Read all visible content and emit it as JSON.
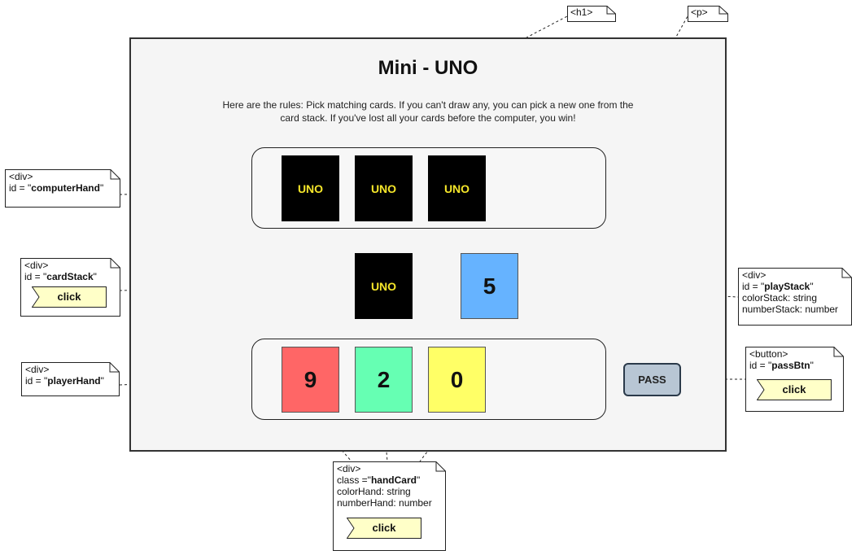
{
  "app": {
    "title": "Mini - UNO",
    "rules": "Here are the rules: Pick matching cards. If you can't draw any, you can pick a new one from the card stack. If you've lost all your cards before the computer, you win!"
  },
  "computer_hand": {
    "cards": [
      "UNO",
      "UNO",
      "UNO"
    ]
  },
  "card_stack": {
    "label": "UNO"
  },
  "play_stack": {
    "number": "5",
    "color": "#66b3ff"
  },
  "player_hand": {
    "cards": [
      {
        "number": "9",
        "color": "#ff6666"
      },
      {
        "number": "2",
        "color": "#66ffb3"
      },
      {
        "number": "0",
        "color": "#ffff66"
      }
    ]
  },
  "pass_button": {
    "label": "PASS"
  },
  "annotations": {
    "h1": {
      "tag": "<h1>"
    },
    "p": {
      "tag": "<p>"
    },
    "computer_hand": {
      "line1": "<div>",
      "line2_prefix": "id = \"",
      "line2_id": "computerHand",
      "line2_suffix": "\""
    },
    "card_stack": {
      "line1": "<div>",
      "line2_prefix": "id = \"",
      "line2_id": "cardStack",
      "line2_suffix": "\"",
      "action": "click"
    },
    "play_stack": {
      "line1": "<div>",
      "line2_prefix": "id = \"",
      "line2_id": "playStack",
      "line2_suffix": "\"",
      "line3": "colorStack: string",
      "line4": "numberStack: number"
    },
    "pass_btn": {
      "line1": "<button>",
      "line2_prefix": "id = \"",
      "line2_id": "passBtn",
      "line2_suffix": "\"",
      "action": "click"
    },
    "player_hand": {
      "line1": "<div>",
      "line2_prefix": "id = \"",
      "line2_id": "playerHand",
      "line2_suffix": "\""
    },
    "hand_card": {
      "line1": "<div>",
      "line2_prefix": "class =\"",
      "line2_id": "handCard",
      "line2_suffix": "\"",
      "line3": "colorHand: string",
      "line4": "numberHand: number",
      "action": "click"
    }
  },
  "colors": {
    "card_back": "#000000",
    "uno_text": "#f5e62a",
    "action_fill": "#ffffc8",
    "button_fill": "#b8c6d4"
  }
}
